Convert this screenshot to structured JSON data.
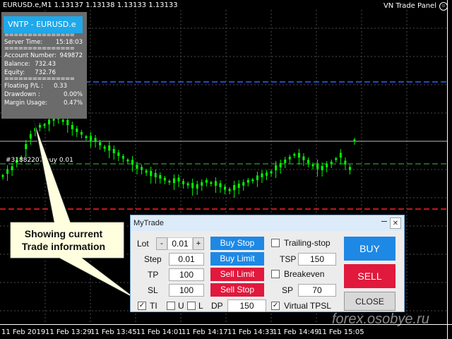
{
  "chart": {
    "symbol_header": "EURUSD.e,M1  1.13137 1.13138 1.13133 1.13133",
    "panel_title": "VN Trade Panel",
    "order_label": "#31882207 buy 0.01",
    "time_labels": [
      "11 Feb 2019",
      "11 Feb 13:29",
      "11 Feb 13:45",
      "11 Feb 14:01",
      "11 Feb 14:17",
      "11 Feb 14:33",
      "11 Feb 14:49",
      "11 Feb 15:05"
    ],
    "watermark": "forex.osobye.ru",
    "colors": {
      "candle": "#00ff00",
      "grid": "#4a4a4a",
      "tp_line": "#3060ff",
      "sl_line": "#ff2020",
      "order_line": "#40c040"
    }
  },
  "info_panel": {
    "title": "VNTP - EURUSD.e",
    "separator": "===============",
    "server_time_label": "Server Time:",
    "server_time": "15:18:03",
    "account_number_label": "Account Number:",
    "account_number": "949872",
    "balance_label": "Balance:",
    "balance": "732.43",
    "equity_label": "Equity:",
    "equity": "732.76",
    "floating_pl_label": "Floating P/L :",
    "floating_pl": "0.33",
    "drawdown_label": "Drawdown :",
    "drawdown": "0.00%",
    "margin_usage_label": "Margin Usage:",
    "margin_usage": "0.47%"
  },
  "callout": {
    "text": "Showing current Trade information"
  },
  "trade_panel": {
    "title": "MyTrade",
    "close_symbol": "✕",
    "lot_label": "Lot",
    "lot_minus": "-",
    "lot_value": "0.01",
    "lot_plus": "+",
    "step_label": "Step",
    "step_value": "0.01",
    "tp_label": "TP",
    "tp_value": "100",
    "sl_label": "SL",
    "sl_value": "100",
    "buy_stop": "Buy Stop",
    "buy_limit": "Buy Limit",
    "sell_limit": "Sell Limit",
    "sell_stop": "Sell Stop",
    "trailing_stop_label": "Trailing-stop",
    "tsp_label": "TSP",
    "tsp_value": "150",
    "breakeven_label": "Breakeven",
    "sp_label": "SP",
    "sp_value": "70",
    "ti_label": "TI",
    "u_label": "U",
    "l_label": "L",
    "dp_label": "DP",
    "dp_value": "150",
    "virtual_tpsl_label": "Virtual TPSL",
    "check_mark": "✓",
    "buy": "BUY",
    "sell": "SELL",
    "close": "CLOSE"
  }
}
